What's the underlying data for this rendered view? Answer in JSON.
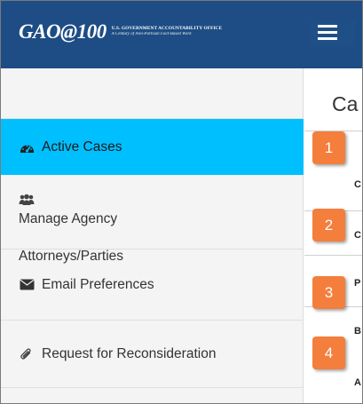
{
  "header": {
    "logo_text": "GAO@100",
    "logo_line1": "U.S. GOVERNMENT ACCOUNTABILITY OFFICE",
    "logo_line2": "A Century of Non-Partisan Fact-Based Work",
    "menu_icon": "hamburger-icon",
    "background_color": "#1d4d84"
  },
  "sidebar": {
    "items": [
      {
        "label": "Active Cases",
        "icon": "dashboard-icon",
        "active": true
      },
      {
        "label_line1": "Manage Agency",
        "label_line2": "Attorneys/Parties",
        "icon": "users-icon",
        "active": false
      },
      {
        "label": "Email Preferences",
        "icon": "envelope-icon",
        "active": false
      },
      {
        "label": "Request for Reconsideration",
        "icon": "paperclip-icon",
        "active": false
      }
    ],
    "active_color": "#00bfff"
  },
  "main": {
    "title_partial": "Ca",
    "row_letters": [
      "C",
      "C",
      "P",
      "B",
      "A"
    ]
  },
  "callouts": [
    "1",
    "2",
    "3",
    "4"
  ],
  "callout_color": "#f47e3c"
}
